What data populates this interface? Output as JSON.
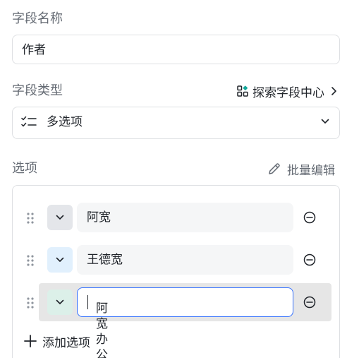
{
  "field_name": {
    "label": "字段名称",
    "value": "作者"
  },
  "field_type": {
    "label": "字段类型",
    "explore_link": "探索字段中心",
    "selected": "多选项",
    "icon": "multi-select-icon"
  },
  "options": {
    "label": "选项",
    "batch_edit": "批量编辑",
    "items": [
      {
        "value": "阿宽",
        "color": "#e4e6ea",
        "focused": false
      },
      {
        "value": "王德宽",
        "color": "#e1f0fd",
        "focused": false
      },
      {
        "value": "阿宽办公",
        "color": "#dcf0e9",
        "focused": true
      }
    ],
    "add_option": "添加选项"
  },
  "colors": {
    "focus_border": "#3370ff",
    "label_gray": "#646a73",
    "explore_icon_teal": "#14a89b"
  }
}
